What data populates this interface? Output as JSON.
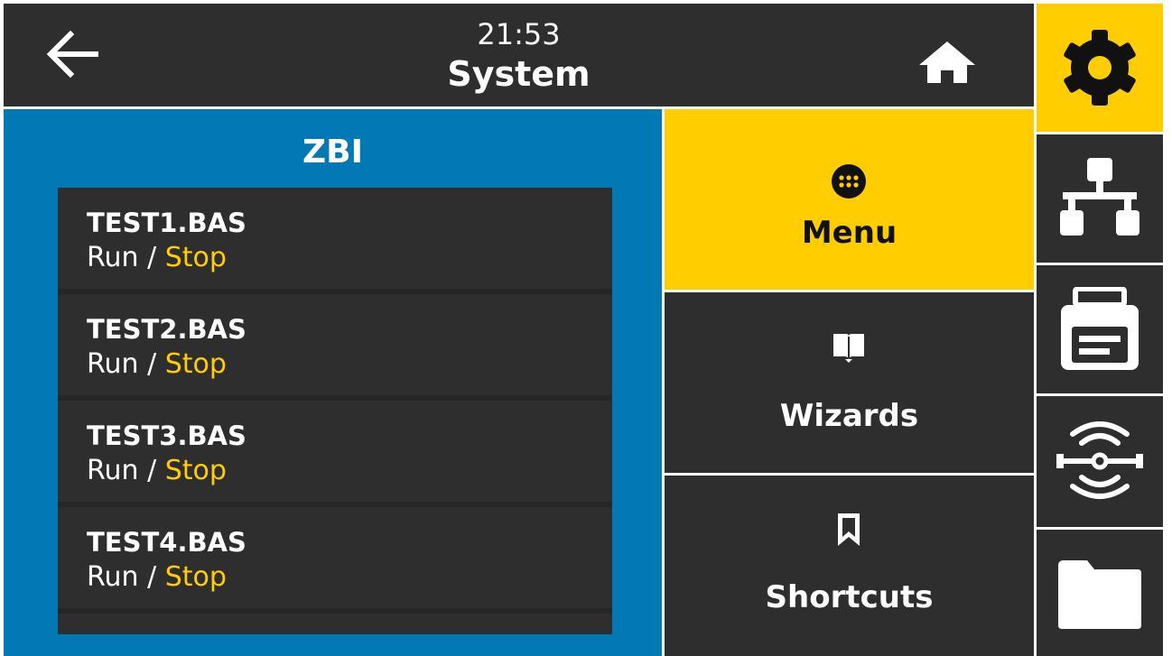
{
  "header": {
    "time": "21:53",
    "title": "System",
    "back_icon": "arrow-left-icon",
    "home_icon": "home-icon"
  },
  "zbi": {
    "title": "ZBI",
    "items": [
      {
        "name": "TEST1.BAS",
        "run": "Run",
        "separator": " / ",
        "stop": "Stop"
      },
      {
        "name": "TEST2.BAS",
        "run": "Run",
        "separator": " / ",
        "stop": "Stop"
      },
      {
        "name": "TEST3.BAS",
        "run": "Run",
        "separator": " / ",
        "stop": "Stop"
      },
      {
        "name": "TEST4.BAS",
        "run": "Run",
        "separator": " / ",
        "stop": "Stop"
      }
    ]
  },
  "menu": {
    "items": [
      {
        "label": "Menu",
        "icon": "dots-grid-icon",
        "active": true
      },
      {
        "label": "Wizards",
        "icon": "book-icon",
        "active": false
      },
      {
        "label": "Shortcuts",
        "icon": "bookmark-icon",
        "active": false
      }
    ]
  },
  "sidebar": {
    "items": [
      {
        "icon": "gear-icon",
        "active": true
      },
      {
        "icon": "network-icon",
        "active": false
      },
      {
        "icon": "printer-icon",
        "active": false
      },
      {
        "icon": "rfid-icon",
        "active": false
      },
      {
        "icon": "folder-icon",
        "active": false
      }
    ]
  },
  "colors": {
    "accent_yellow": "#ffcd00",
    "panel_blue": "#0279b5",
    "dark": "#2e2e2e",
    "stop_text": "#ffcd00"
  }
}
